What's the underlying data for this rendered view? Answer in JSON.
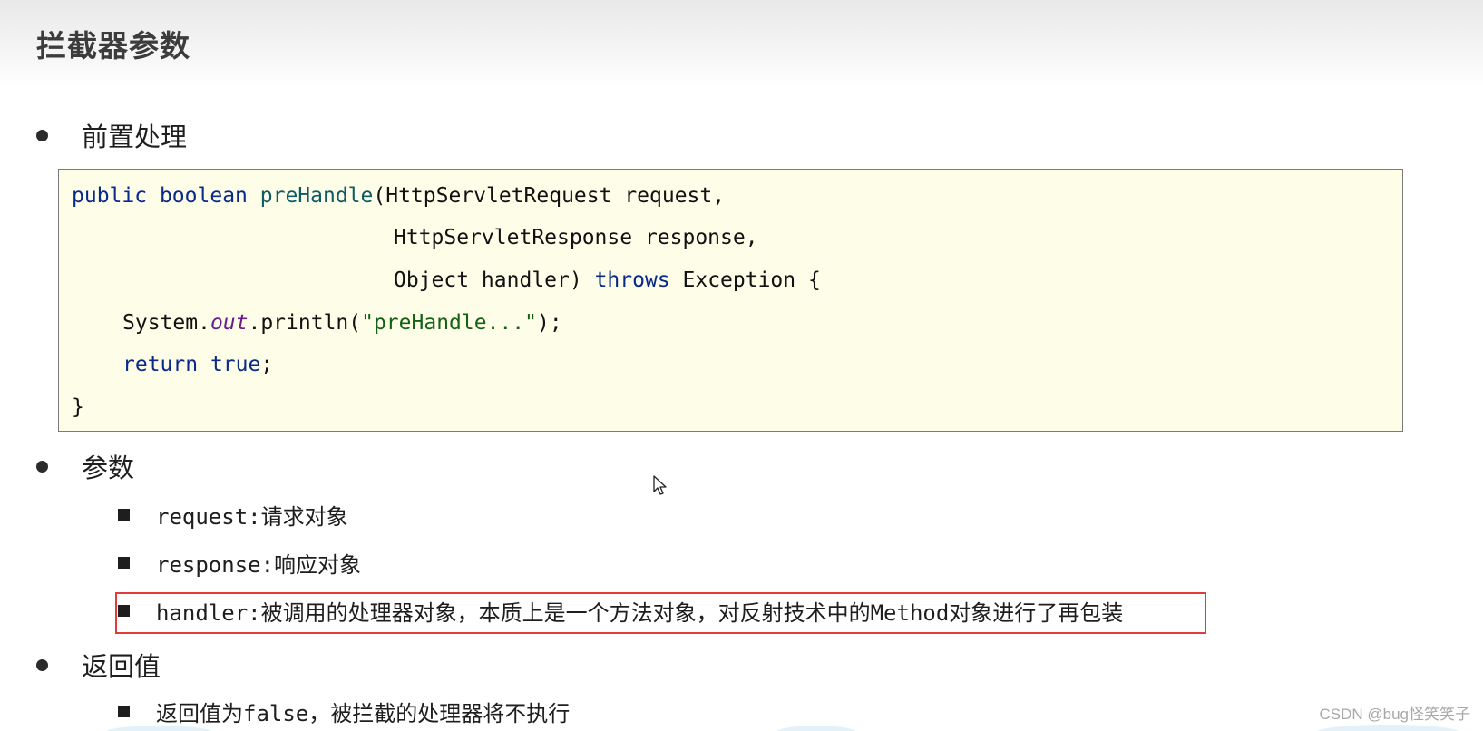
{
  "page": {
    "title": "拦截器参数"
  },
  "sections": {
    "pre": {
      "label": "前置处理"
    },
    "params": {
      "label": "参数"
    },
    "ret": {
      "label": "返回值"
    }
  },
  "code": {
    "line1": {
      "kw1": "public",
      "kw2": "boolean",
      "method": "preHandle",
      "rest": "(HttpServletRequest request,"
    },
    "line2": {
      "text": "HttpServletResponse response,"
    },
    "line3": {
      "pre": "Object handler) ",
      "kw": "throws",
      "post": " Exception {"
    },
    "line4": {
      "pre": "System.",
      "field": "out",
      "mid": ".println(",
      "str": "\"preHandle...\"",
      "post": ");"
    },
    "line5": {
      "kw1": "return",
      "kw2": "true",
      "post": ";"
    },
    "line6": {
      "text": "}"
    }
  },
  "params": {
    "p1": {
      "name": "request:",
      "desc": "请求对象"
    },
    "p2": {
      "name": "response:",
      "desc": "响应对象"
    },
    "p3": {
      "name": "handler:",
      "desc1": "被调用的处理器对象，本质上是一个方法对象，对反射技术中的",
      "mono": "Method",
      "desc2": "对象进行了再包装"
    }
  },
  "returns": {
    "r1": {
      "pre": "返回值为",
      "mono": "false",
      "post": "，被拦截的处理器将不执行"
    }
  },
  "watermark": "CSDN @bug怪笑笑子",
  "colors": {
    "code_bg": "#fdfde8",
    "keyword": "#0a2a8a",
    "string": "#146114",
    "highlight_border": "#e23b3b"
  }
}
